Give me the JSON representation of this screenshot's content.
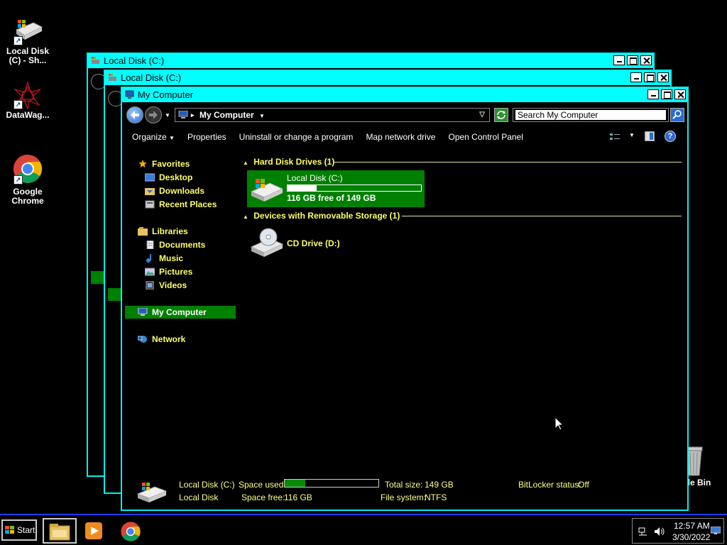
{
  "desktop": {
    "icons": [
      {
        "label": "Local Disk (C) - Sh..."
      },
      {
        "label": "DataWag..."
      },
      {
        "label": "Google Chrome"
      },
      {
        "label": "cle Bin"
      }
    ]
  },
  "windows": {
    "back1": {
      "title": "Local Disk (C:)"
    },
    "back2": {
      "title": "Local Disk (C:)"
    },
    "main": {
      "title": "My Computer",
      "address": "My Computer",
      "search_placeholder": "Search My Computer",
      "commands": [
        "Organize",
        "Properties",
        "Uninstall or change a program",
        "Map network drive",
        "Open Control Panel"
      ],
      "nav": {
        "favorites": "Favorites",
        "desktop": "Desktop",
        "downloads": "Downloads",
        "recent": "Recent Places",
        "libraries": "Libraries",
        "documents": "Documents",
        "music": "Music",
        "pictures": "Pictures",
        "videos": "Videos",
        "computer": "My Computer",
        "network": "Network"
      },
      "groups": {
        "hdd": "Hard Disk Drives (1)",
        "removable": "Devices with Removable Storage (1)"
      },
      "drives": {
        "c": {
          "name": "Local Disk (C:)",
          "free": "116 GB free of 149 GB",
          "used_fraction": 0.22
        },
        "d": {
          "name": "CD Drive (D:)"
        }
      },
      "status": {
        "name": "Local Disk (C:)",
        "type": "Local Disk",
        "space_used_label": "Space used:",
        "space_free_label": "Space free:",
        "space_free": "116 GB",
        "total_label": "Total size:",
        "total": "149 GB",
        "fs_label": "File system:",
        "fs": "NTFS",
        "bitlocker_label": "BitLocker status:",
        "bitlocker": "Off",
        "used_fraction": 0.22
      }
    }
  },
  "taskbar": {
    "start": "Start",
    "time": "12:57 AM",
    "date": "3/30/2022"
  }
}
